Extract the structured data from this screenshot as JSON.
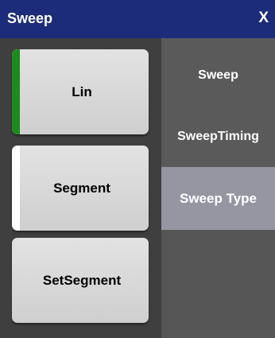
{
  "window": {
    "title": "Sweep",
    "close_label": "X"
  },
  "options": [
    {
      "label": "Lin",
      "indicator": "green",
      "indicator_color": "#1c8a1c"
    },
    {
      "label": "Segment",
      "indicator": "white",
      "indicator_color": "#ffffff"
    },
    {
      "label": "SetSegment",
      "indicator": "none"
    }
  ],
  "tabs": [
    {
      "label": "Sweep"
    },
    {
      "label": "SweepTiming"
    },
    {
      "label": "Sweep Type",
      "active": true
    }
  ],
  "colors": {
    "titlebar": "#1c2c7a",
    "background": "#3f3f3f",
    "tab_panel": "#565656",
    "tab_active": "#9696a3"
  }
}
